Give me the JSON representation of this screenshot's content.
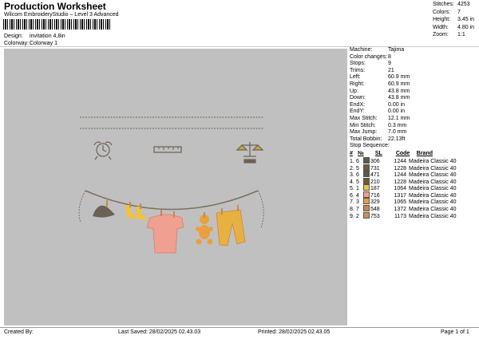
{
  "header": {
    "title": "Production Worksheet",
    "subtitle": "Wilcom EmbroideryStudio – Level 3 Advanced",
    "design_label": "Design:",
    "design_value": "invitation 4,8in",
    "colorway_label": "Colorway:",
    "colorway_value": "Colorway 1"
  },
  "stats": [
    {
      "label": "Stitches:",
      "value": "4253"
    },
    {
      "label": "Colors:",
      "value": "7"
    },
    {
      "label": "Height:",
      "value": "3.45 in"
    },
    {
      "label": "Width:",
      "value": "4.80 in"
    },
    {
      "label": "Zoom:",
      "value": "1:1"
    }
  ],
  "machine_info": [
    {
      "label": "Machine:",
      "value": "Tajima"
    },
    {
      "label": "Color changes:",
      "value": "8"
    },
    {
      "label": "Stops:",
      "value": "9"
    },
    {
      "label": "Trims:",
      "value": "21"
    },
    {
      "label": "Left:",
      "value": "60.9 mm"
    },
    {
      "label": "Right:",
      "value": "60.9 mm"
    },
    {
      "label": "Up:",
      "value": "43.8 mm"
    },
    {
      "label": "Down:",
      "value": "43.8 mm"
    },
    {
      "label": "EndX:",
      "value": "0.00 in"
    },
    {
      "label": "EndY:",
      "value": "0.00 in"
    },
    {
      "label": "Max Stitch:",
      "value": "12.1 mm"
    },
    {
      "label": "Min Stitch:",
      "value": "0.3 mm"
    },
    {
      "label": "Max Jump:",
      "value": "7.0 mm"
    },
    {
      "label": "Total Bobbin:",
      "value": "22.13ft"
    }
  ],
  "sequence": {
    "heading": "Stop Sequence:",
    "columns": [
      "#",
      "№",
      "SL",
      "Code",
      "Brand"
    ],
    "rows": [
      {
        "num": "1.",
        "n": "6",
        "color": "#5a5a4a",
        "sl": "306",
        "code": "1244",
        "brand": "Madeira Classic 40"
      },
      {
        "num": "2.",
        "n": "5",
        "color": "#6b5b3a",
        "sl": "731",
        "code": "1228",
        "brand": "Madeira Classic 40"
      },
      {
        "num": "3.",
        "n": "6",
        "color": "#5a5a4a",
        "sl": "471",
        "code": "1244",
        "brand": "Madeira Classic 40"
      },
      {
        "num": "4.",
        "n": "5",
        "color": "#6b5b3a",
        "sl": "210",
        "code": "1228",
        "brand": "Madeira Classic 40"
      },
      {
        "num": "5.",
        "n": "1",
        "color": "#f2c23a",
        "sl": "187",
        "code": "1064",
        "brand": "Madeira Classic 40"
      },
      {
        "num": "6.",
        "n": "4",
        "color": "#f0a090",
        "sl": "716",
        "code": "1317",
        "brand": "Madeira Classic 40"
      },
      {
        "num": "7.",
        "n": "3",
        "color": "#e8a040",
        "sl": "329",
        "code": "1065",
        "brand": "Madeira Classic 40"
      },
      {
        "num": "8.",
        "n": "7",
        "color": "#c88848",
        "sl": "548",
        "code": "1372",
        "brand": "Madeira Classic 40"
      },
      {
        "num": "9.",
        "n": "2",
        "color": "#c89058",
        "sl": "753",
        "code": "1173",
        "brand": "Madeira Classic 40"
      }
    ]
  },
  "footer": {
    "created": "Created By:",
    "last_saved": "Last Saved: 28/02/2025 02.43.03",
    "printed": "Printed: 28/02/2025 02.43.05",
    "page": "Page 1 of 1"
  },
  "colors": {
    "canvas_bg": "#c0c0c0",
    "stitch_line": "#6a6255",
    "rope": "#7a7060",
    "yellow": "#f2c23a",
    "pink": "#f0a090",
    "orange": "#e8a040",
    "tan": "#c88848"
  }
}
